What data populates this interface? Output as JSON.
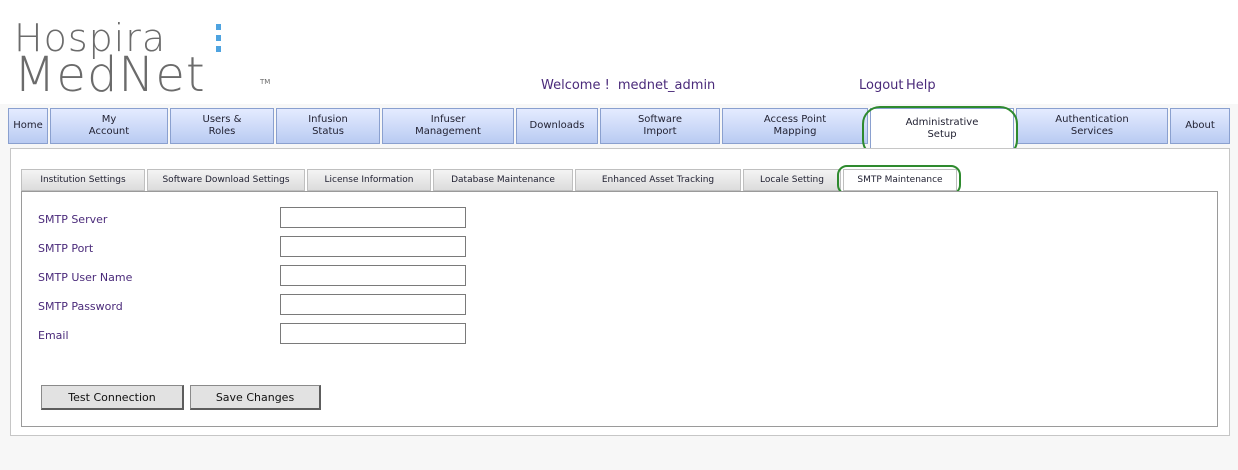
{
  "header": {
    "logo_line1": "Hospira",
    "logo_line2": "MedNet",
    "logo_tm": "TM",
    "welcome_text": "Welcome !",
    "username": "mednet_admin",
    "logout_label": "Logout",
    "help_label": "Help"
  },
  "nav": {
    "tabs": [
      {
        "label": "Home"
      },
      {
        "label": "My\nAccount"
      },
      {
        "label": "Users &\nRoles"
      },
      {
        "label": "Infusion\nStatus"
      },
      {
        "label": "Infuser\nManagement"
      },
      {
        "label": "Downloads"
      },
      {
        "label": "Software\nImport"
      },
      {
        "label": "Access Point\nMapping"
      },
      {
        "label": "Administrative\nSetup"
      },
      {
        "label": "Authentication\nServices"
      },
      {
        "label": "About"
      }
    ],
    "active_tab": "Administrative Setup"
  },
  "subtabs": {
    "items": [
      {
        "label": "Institution Settings"
      },
      {
        "label": "Software Download Settings"
      },
      {
        "label": "License Information"
      },
      {
        "label": "Database Maintenance"
      },
      {
        "label": "Enhanced Asset Tracking"
      },
      {
        "label": "Locale Setting"
      },
      {
        "label": "SMTP Maintenance"
      }
    ],
    "active": "SMTP Maintenance"
  },
  "form": {
    "fields": [
      {
        "label": "SMTP Server",
        "value": ""
      },
      {
        "label": "SMTP Port",
        "value": ""
      },
      {
        "label": "SMTP User Name",
        "value": ""
      },
      {
        "label": "SMTP Password",
        "value": ""
      },
      {
        "label": "Email",
        "value": ""
      }
    ],
    "test_connection_label": "Test Connection",
    "save_changes_label": "Save Changes"
  },
  "colors": {
    "highlight": "#2e8a2e",
    "label_text": "#4a2a7a",
    "tab_blue": "#b9cbf2"
  }
}
